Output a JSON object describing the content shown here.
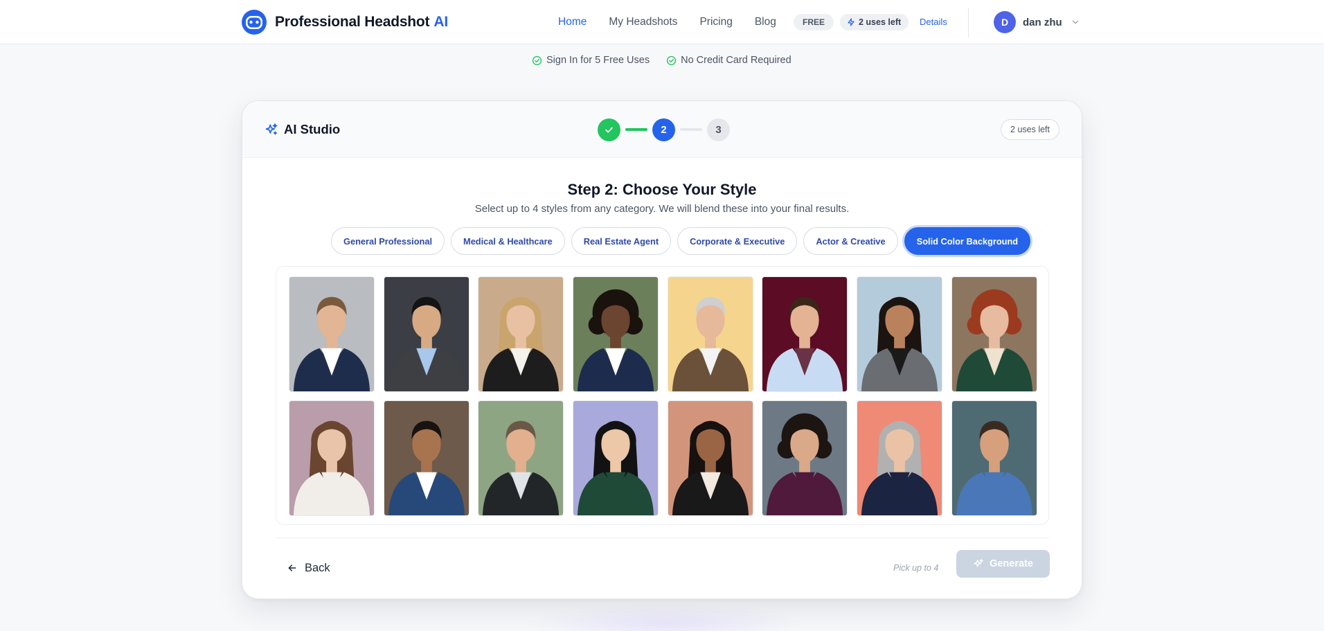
{
  "brand": {
    "name": "Professional Headshot",
    "accent": "AI",
    "logo_icon": "robot-face-icon"
  },
  "nav": {
    "items": [
      {
        "label": "Home",
        "active": true
      },
      {
        "label": "My Headshots",
        "active": false
      },
      {
        "label": "Pricing",
        "active": false
      },
      {
        "label": "Blog",
        "active": false
      }
    ],
    "plan_badge": "FREE",
    "uses_left": "2 uses left",
    "details_link": "Details"
  },
  "user": {
    "initial": "D",
    "name": "dan zhu"
  },
  "trust": [
    {
      "label": "Sign In for 5 Free Uses",
      "icon": "check-circle-icon"
    },
    {
      "label": "No Credit Card Required",
      "icon": "check-circle-icon"
    }
  ],
  "studio": {
    "title": "AI Studio",
    "uses_badge": "2 uses left",
    "steps": [
      {
        "label": "",
        "state": "done"
      },
      {
        "label": "2",
        "state": "current"
      },
      {
        "label": "3",
        "state": "todo"
      }
    ],
    "step_title": "Step 2: Choose Your Style",
    "step_subtitle": "Select up to 4 styles from any category. We will blend these into your final results.",
    "tabs": [
      {
        "label": "General Professional",
        "active": false
      },
      {
        "label": "Medical & Healthcare",
        "active": false
      },
      {
        "label": "Real Estate Agent",
        "active": false
      },
      {
        "label": "Corporate & Executive",
        "active": false
      },
      {
        "label": "Actor & Creative",
        "active": false
      },
      {
        "label": "Solid Color Background",
        "active": true
      }
    ],
    "styles": [
      {
        "bg": "#b9bcc0",
        "skin": "#e2b594",
        "hair": "#7a5a3c",
        "outfit": "#1f2d4d",
        "inner": "#ffffff",
        "hairStyle": "short"
      },
      {
        "bg": "#3b3e44",
        "skin": "#d7aa83",
        "hair": "#141414",
        "outfit": "#3d3f43",
        "inner": "#a9c7ea",
        "hairStyle": "short"
      },
      {
        "bg": "#c9ab8c",
        "skin": "#e8c0a2",
        "hair": "#c9a46c",
        "outfit": "#1d1d1d",
        "inner": "#f4f1ec",
        "hairStyle": "long"
      },
      {
        "bg": "#6b7f5b",
        "skin": "#6b4530",
        "hair": "#1a120d",
        "outfit": "#1d2c4d",
        "inner": "#ffffff",
        "hairStyle": "curly"
      },
      {
        "bg": "#f5d58e",
        "skin": "#e6b99a",
        "hair": "#cfcfcf",
        "outfit": "#6b513a",
        "inner": "#f4f4f4",
        "hairStyle": "short"
      },
      {
        "bg": "#5c0c24",
        "skin": "#e3b393",
        "hair": "#3b2717",
        "outfit": "#c7dcf3",
        "inner": "#6a3245",
        "hairStyle": "short"
      },
      {
        "bg": "#b4cbdc",
        "skin": "#b9825d",
        "hair": "#1c1410",
        "outfit": "#6a6d72",
        "inner": "#1a1a1a",
        "hairStyle": "long"
      },
      {
        "bg": "#8c7660",
        "skin": "#e6bba0",
        "hair": "#9b3a1f",
        "outfit": "#1e4a37",
        "inner": "#efe2cf",
        "hairStyle": "curly"
      },
      {
        "bg": "#b99dab",
        "skin": "#eac4aa",
        "hair": "#6a4530",
        "outfit": "#f1ede8",
        "inner": "#f1ede8",
        "hairStyle": "long"
      },
      {
        "bg": "#6d5a4b",
        "skin": "#a8734f",
        "hair": "#181310",
        "outfit": "#27497a",
        "inner": "#ffffff",
        "hairStyle": "short"
      },
      {
        "bg": "#8ea583",
        "skin": "#e2b08e",
        "hair": "#6a5847",
        "outfit": "#222629",
        "inner": "#dfe4e9",
        "hairStyle": "short"
      },
      {
        "bg": "#aaa9db",
        "skin": "#ecc7a8",
        "hair": "#121212",
        "outfit": "#1f4a37",
        "inner": "#1f4a37",
        "hairStyle": "long"
      },
      {
        "bg": "#d2957c",
        "skin": "#9a6544",
        "hair": "#171110",
        "outfit": "#191919",
        "inner": "#f2e9df",
        "hairStyle": "long"
      },
      {
        "bg": "#6d7a86",
        "skin": "#d9a98a",
        "hair": "#1d1512",
        "outfit": "#4f1a3c",
        "inner": "#4f1a3c",
        "hairStyle": "curly"
      },
      {
        "bg": "#ee8a76",
        "skin": "#eac3a6",
        "hair": "#b1b1b1",
        "outfit": "#1b2440",
        "inner": "#1b2440",
        "hairStyle": "long"
      },
      {
        "bg": "#4e6b74",
        "skin": "#d6a07c",
        "hair": "#3a2b21",
        "outfit": "#4a77b8",
        "inner": "#4a77b8",
        "hairStyle": "short"
      }
    ],
    "back_label": "Back",
    "pick_hint": "Pick up to 4",
    "generate_label": "Generate"
  },
  "colors": {
    "primary": "#2563eb",
    "success": "#22c55e",
    "disabled": "#cbd5e1"
  }
}
